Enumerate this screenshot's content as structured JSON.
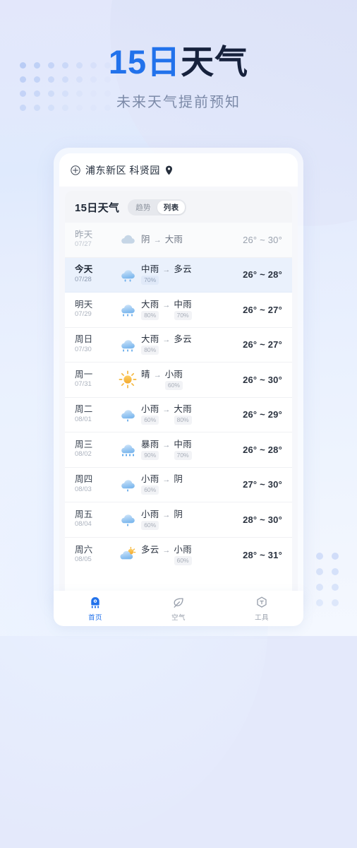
{
  "hero": {
    "title_blue": "15日",
    "title_dark": "天气",
    "subtitle": "未来天气提前预知"
  },
  "colors": {
    "accent_blue": "#2272eb",
    "title_dark": "#16213c",
    "subtitle_gray": "#7c8aa8",
    "today_row_bg": "#eaf1fc",
    "rain_icon": "#8ec2f2",
    "sun_icon": "#f5b73f",
    "page_bg": "#e4e9fb",
    "dot_grid": "#b9ccf5"
  },
  "location_bar": {
    "add_icon": "circle-plus-icon",
    "text": "浦东新区 科贤园",
    "pin_icon": "location-pin-icon"
  },
  "card": {
    "title": "15日天气",
    "segments": [
      {
        "label": "趋势",
        "active": false
      },
      {
        "label": "列表",
        "active": true
      }
    ]
  },
  "forecast_rows": [
    {
      "day": "昨天",
      "date": "07/27",
      "state": "past",
      "icon": "cloudy-icon",
      "from": {
        "text": "阴",
        "pct": ""
      },
      "arrow": "→",
      "to": {
        "text": "大雨",
        "pct": ""
      },
      "temp": "26° ~ 30°"
    },
    {
      "day": "今天",
      "date": "07/28",
      "state": "today",
      "icon": "moderate-rain-icon",
      "from": {
        "text": "中雨",
        "pct": "70%"
      },
      "arrow": "→",
      "to": {
        "text": "多云",
        "pct": ""
      },
      "temp": "26° ~ 28°"
    },
    {
      "day": "明天",
      "date": "07/29",
      "state": "normal",
      "icon": "heavy-rain-icon",
      "from": {
        "text": "大雨",
        "pct": "80%"
      },
      "arrow": "→",
      "to": {
        "text": "中雨",
        "pct": "70%"
      },
      "temp": "26° ~ 27°"
    },
    {
      "day": "周日",
      "date": "07/30",
      "state": "normal",
      "icon": "heavy-rain-icon",
      "from": {
        "text": "大雨",
        "pct": "80%"
      },
      "arrow": "→",
      "to": {
        "text": "多云",
        "pct": ""
      },
      "temp": "26° ~ 27°"
    },
    {
      "day": "周一",
      "date": "07/31",
      "state": "normal",
      "icon": "sunny-icon",
      "from": {
        "text": "晴",
        "pct": ""
      },
      "arrow": "→",
      "to": {
        "text": "小雨",
        "pct": "60%"
      },
      "temp": "26° ~ 30°"
    },
    {
      "day": "周二",
      "date": "08/01",
      "state": "normal",
      "icon": "light-rain-icon",
      "from": {
        "text": "小雨",
        "pct": "60%"
      },
      "arrow": "→",
      "to": {
        "text": "大雨",
        "pct": "80%"
      },
      "temp": "26° ~ 29°"
    },
    {
      "day": "周三",
      "date": "08/02",
      "state": "normal",
      "icon": "storm-rain-icon",
      "from": {
        "text": "暴雨",
        "pct": "90%"
      },
      "arrow": "→",
      "to": {
        "text": "中雨",
        "pct": "70%"
      },
      "temp": "26° ~ 28°"
    },
    {
      "day": "周四",
      "date": "08/03",
      "state": "normal",
      "icon": "light-rain-icon",
      "from": {
        "text": "小雨",
        "pct": "60%"
      },
      "arrow": "→",
      "to": {
        "text": "阴",
        "pct": ""
      },
      "temp": "27° ~ 30°"
    },
    {
      "day": "周五",
      "date": "08/04",
      "state": "normal",
      "icon": "light-rain-icon",
      "from": {
        "text": "小雨",
        "pct": "60%"
      },
      "arrow": "→",
      "to": {
        "text": "阴",
        "pct": ""
      },
      "temp": "28° ~ 30°"
    },
    {
      "day": "周六",
      "date": "08/05",
      "state": "normal",
      "icon": "partly-cloudy-icon",
      "from": {
        "text": "多云",
        "pct": ""
      },
      "arrow": "→",
      "to": {
        "text": "小雨",
        "pct": "60%"
      },
      "temp": "28° ~ 31°"
    }
  ],
  "tabbar": [
    {
      "label": "首页",
      "icon": "home-weather-icon",
      "active": true
    },
    {
      "label": "空气",
      "icon": "leaf-icon",
      "active": false
    },
    {
      "label": "工具",
      "icon": "tools-hexagon-icon",
      "active": false
    }
  ]
}
